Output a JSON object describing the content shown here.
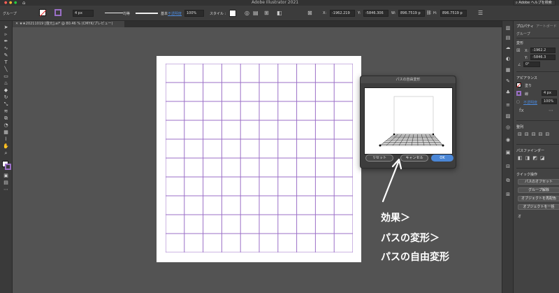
{
  "app": {
    "title": "Adobe Illustrator 2021"
  },
  "control_bar": {
    "selection_label": "グループ",
    "stroke_width": "4 px",
    "stroke_style": "均等",
    "brush": "基本",
    "opacity_label": "不透明度",
    "opacity_value": "100%",
    "style_label": "スタイル :",
    "x_label": "X:",
    "x_value": "-1962.219",
    "y_label": "Y:",
    "y_value": "-5846.306",
    "w_label": "W:",
    "w_value": "896.7519 p",
    "h_label": "H:",
    "h_value": "896.7519 p",
    "search_placeholder": "Adobe ヘルプを検索"
  },
  "document": {
    "tab_label": "★★20211019 [復元].ai* @ 80.46 % (CMYK/プレビュー)"
  },
  "dialog": {
    "title": "パスの自由変形",
    "reset_label": "リセット",
    "cancel_label": "キャンセル",
    "ok_label": "OK"
  },
  "panel": {
    "tab_properties": "プロパティ",
    "tab_artboard": "アートボード",
    "group_label": "グループ",
    "transform_heading": "変形",
    "x_label": "X:",
    "x_value": "-1962.2",
    "y_label": "Y:",
    "y_value": "-5846.3",
    "angle_value": "0°",
    "appearance_heading": "アピアランス",
    "fill_label": "塗り",
    "stroke_label": "線",
    "stroke_value": "4 px",
    "opacity_label": "不透明度",
    "opacity_value": "100%",
    "align_heading": "整列",
    "pathfinder_heading": "パスファインダー",
    "quick_actions_heading": "クイック操作",
    "btn_offset_path": "パスのオフセット",
    "btn_ungroup": "グループ解除",
    "btn_recolor": "オブジェクトを再配色",
    "btn_recolor2": "オブジェクトを一括",
    "offset_label": "オ"
  },
  "annotation": {
    "line1": "効果＞",
    "line2": "パスの変形＞",
    "line3": "パスの自由変形"
  },
  "colors": {
    "grid_line": "#9b6fc7",
    "ok_button": "#4a86d6",
    "canvas": "#535353"
  },
  "icons": [
    "home-icon",
    "selection-tool-icon",
    "direct-selection-icon",
    "pen-icon",
    "type-icon",
    "brush-icon",
    "zoom-icon",
    "hand-icon",
    "layers-icon",
    "swatches-icon",
    "search-icon"
  ]
}
